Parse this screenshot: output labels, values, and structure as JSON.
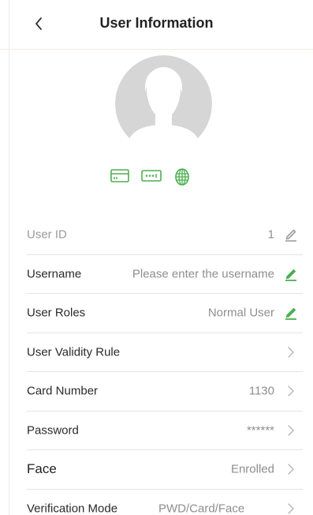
{
  "header": {
    "title": "User Information",
    "back_icon": "chevron-left-icon"
  },
  "avatar": {
    "icon": "user-silhouette-icon"
  },
  "status_icons": [
    {
      "name": "card-icon",
      "color": "#4caf50"
    },
    {
      "name": "password-icon",
      "color": "#4caf50"
    },
    {
      "name": "fingerprint-icon",
      "color": "#4caf50"
    }
  ],
  "colors": {
    "accent": "#4caf50",
    "disabled_icon": "#9e9e9e",
    "divider": "#e4e4e4",
    "avatar_bg": "#d6d6d6"
  },
  "fields": {
    "user_id": {
      "label": "User ID",
      "value": "1",
      "action_icon": "edit-icon",
      "enabled": false
    },
    "username": {
      "label": "Username",
      "placeholder": "Please enter the username",
      "action_icon": "edit-icon"
    },
    "user_roles": {
      "label": "User Roles",
      "value": "Normal User",
      "action_icon": "edit-icon"
    },
    "user_validity_rule": {
      "label": "User Validity Rule",
      "value": "",
      "action_icon": "chevron-right-icon"
    },
    "card_number": {
      "label": "Card Number",
      "value": "1130",
      "action_icon": "chevron-right-icon"
    },
    "password": {
      "label": "Password",
      "value": "******",
      "action_icon": "chevron-right-icon"
    },
    "face": {
      "label": "Face",
      "value": "Enrolled",
      "action_icon": "chevron-right-icon"
    },
    "verification_mode": {
      "label": "Verification Mode",
      "value": "PWD/Card/Face",
      "action_icon": "chevron-right-icon"
    }
  }
}
